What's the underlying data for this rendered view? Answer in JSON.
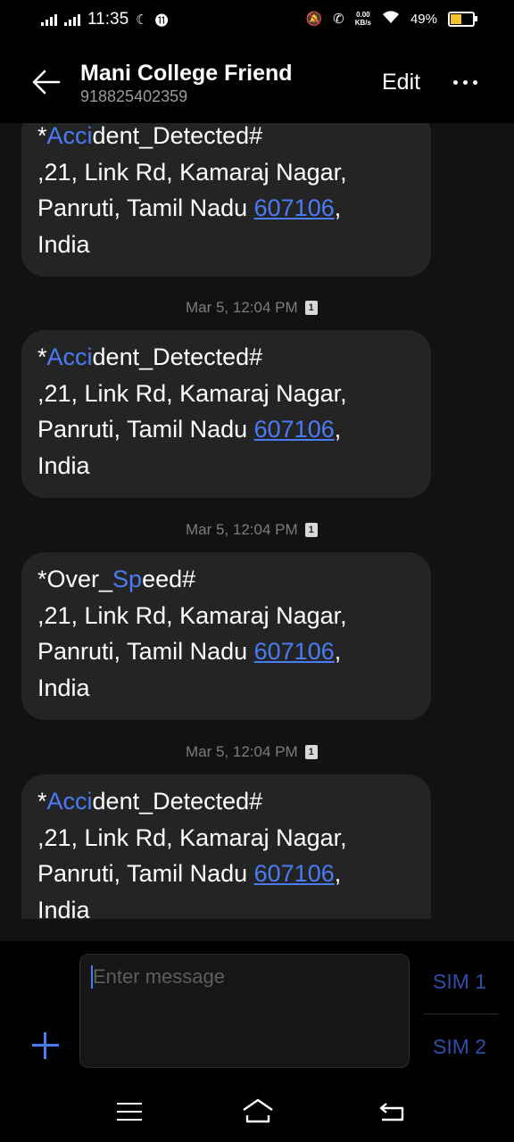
{
  "status_bar": {
    "time": "11:35",
    "net_speed_top": "0.00",
    "net_speed_bottom": "KB/s",
    "battery": "49%"
  },
  "header": {
    "contact_name": "Mani College Friend",
    "phone_number": "918825402359",
    "edit_label": "Edit"
  },
  "messages": [
    {
      "prefix": "*",
      "hl": "Acci",
      "rest": "dent_Detected#",
      "line2": ",21, Link Rd, Kamaraj Nagar,",
      "line3_pre": "Panruti, Tamil Nadu ",
      "pin": "607106",
      "line3_post": ",",
      "line4": "India"
    },
    {
      "prefix": "*",
      "hl": "Acci",
      "rest": "dent_Detected#",
      "line2": ",21, Link Rd, Kamaraj Nagar,",
      "line3_pre": "Panruti, Tamil Nadu ",
      "pin": "607106",
      "line3_post": ",",
      "line4": "India"
    },
    {
      "prefix": "*Over_",
      "hl": "Sp",
      "rest": "eed#",
      "line2": ",21, Link Rd, Kamaraj Nagar,",
      "line3_pre": "Panruti, Tamil Nadu ",
      "pin": "607106",
      "line3_post": ",",
      "line4": "India"
    },
    {
      "prefix": "*",
      "hl": "Acci",
      "rest": "dent_Detected#",
      "line2": ",21, Link Rd, Kamaraj Nagar,",
      "line3_pre": "Panruti, Tamil Nadu ",
      "pin": "607106",
      "line3_post": ",",
      "line4": "India"
    }
  ],
  "timestamps": [
    {
      "text": "Mar 5, 12:04 PM",
      "sim": "1"
    },
    {
      "text": "Mar 5, 12:04 PM",
      "sim": "1"
    },
    {
      "text": "Mar 5, 12:04 PM",
      "sim": "1"
    }
  ],
  "composer": {
    "placeholder": "Enter message",
    "sim1_label": "SIM 1",
    "sim2_label": "SIM 2"
  },
  "colors": {
    "accent": "#4a7cf5",
    "bubble": "#242424",
    "background": "#121212"
  },
  "icons": [
    "back-arrow-icon",
    "more-icon",
    "add-icon",
    "menu-icon",
    "home-icon",
    "back-icon"
  ]
}
